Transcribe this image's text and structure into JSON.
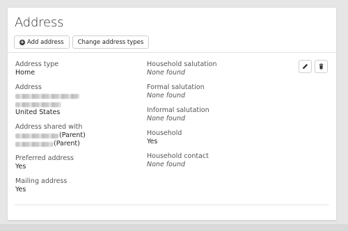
{
  "panel": {
    "title": "Address"
  },
  "toolbar": {
    "add_address_label": "Add address",
    "change_types_label": "Change address types"
  },
  "record": {
    "address_type": {
      "label": "Address type",
      "value": "Home"
    },
    "address": {
      "label": "Address",
      "country": "United States"
    },
    "address_shared_with": {
      "label": "Address shared with",
      "entries": [
        {
          "suffix": "(Parent)"
        },
        {
          "suffix": "(Parent)"
        }
      ]
    },
    "preferred_address": {
      "label": "Preferred address",
      "value": "Yes"
    },
    "mailing_address": {
      "label": "Mailing address",
      "value": "Yes"
    },
    "household_salutation": {
      "label": "Household salutation",
      "value": "None found"
    },
    "formal_salutation": {
      "label": "Formal salutation",
      "value": "None found"
    },
    "informal_salutation": {
      "label": "Informal salutation",
      "value": "None found"
    },
    "household": {
      "label": "Household",
      "value": "Yes"
    },
    "household_contact": {
      "label": "Household contact",
      "value": "None found"
    }
  },
  "icons": {
    "add": "plus-circle-icon",
    "edit": "pencil-icon",
    "delete": "trash-icon"
  }
}
